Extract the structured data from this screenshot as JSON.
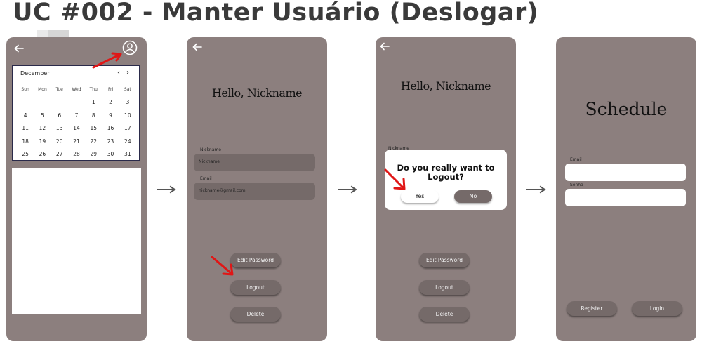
{
  "page": {
    "title": "UC #002 - Manter Usuário (Deslogar)"
  },
  "colors": {
    "phone_bg": "#8c7f7e",
    "field_bg": "#756a69",
    "annotation": "#e01616",
    "flow_arrow": "#555555"
  },
  "screen1": {
    "calendar": {
      "month": "December",
      "weekdays": [
        "Sun",
        "Mon",
        "Tue",
        "Wed",
        "Thu",
        "Fri",
        "Sat"
      ],
      "weeks": [
        [
          "",
          "",
          "",
          "",
          "1",
          "2",
          "3"
        ],
        [
          "4",
          "5",
          "6",
          "7",
          "8",
          "9",
          "10"
        ],
        [
          "11",
          "12",
          "13",
          "14",
          "15",
          "16",
          "17"
        ],
        [
          "18",
          "19",
          "20",
          "21",
          "22",
          "23",
          "24"
        ],
        [
          "25",
          "26",
          "27",
          "28",
          "29",
          "30",
          "31"
        ]
      ]
    }
  },
  "screen2": {
    "greeting": "Hello, Nickname",
    "nickname_label": "Nickname",
    "nickname_value": "Nickname",
    "email_label": "Email",
    "email_value": "nickname@gmail.com",
    "edit_password": "Edit Password",
    "logout": "Logout",
    "delete": "Delete"
  },
  "screen3": {
    "greeting": "Hello, Nickname",
    "nickname_label": "Nickname",
    "dialog_question": "Do you really want to Logout?",
    "yes": "Yes",
    "no": "No",
    "edit_password": "Edit Password",
    "logout": "Logout",
    "delete": "Delete"
  },
  "screen4": {
    "title": "Schedule",
    "email_label": "Email",
    "password_label": "Senha",
    "register": "Register",
    "login": "Login"
  },
  "icons": {
    "back": "arrow-left-icon",
    "profile": "user-circle-icon",
    "prev": "chevron-left-icon",
    "next": "chevron-right-icon"
  }
}
